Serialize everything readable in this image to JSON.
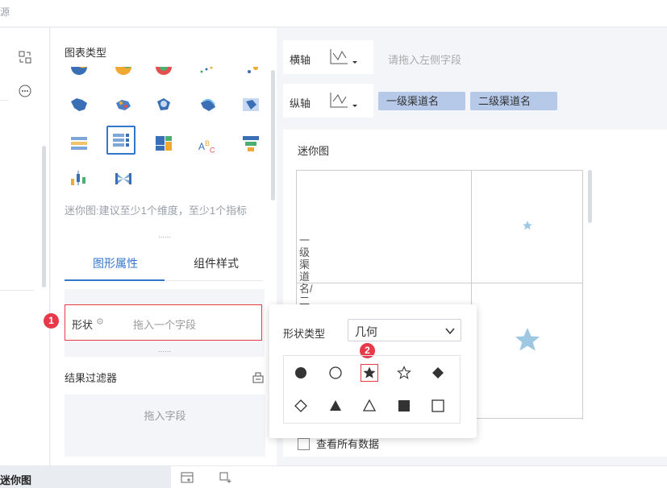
{
  "header": {
    "crumb": "源"
  },
  "chart_type_panel": {
    "title": "图表类型",
    "hint": "迷你图:建议至少1个维度，至少1个指标"
  },
  "tabs": [
    {
      "label": "图形属性"
    },
    {
      "label": "组件样式"
    }
  ],
  "shape_field": {
    "label": "形状",
    "placeholder": "拖入一个字段",
    "badge": "1"
  },
  "result_filter": {
    "title": "结果过滤器",
    "placeholder": "拖入字段"
  },
  "axes": {
    "x": {
      "label": "横轴",
      "placeholder": "请拖入左侧字段"
    },
    "y": {
      "label": "纵轴",
      "chips": [
        "一级渠道名",
        "二级渠道名"
      ]
    }
  },
  "canvas": {
    "title": "迷你图",
    "y_axis_label": "一级渠道名/二",
    "show_all": "查看所有数据",
    "star_color": "#9ec8e2"
  },
  "shape_popover": {
    "label": "形状类型",
    "selected": "几何",
    "badge": "2",
    "shapes": [
      "filled-circle",
      "hollow-circle",
      "filled-star",
      "hollow-star",
      "filled-diamond",
      "hollow-diamond",
      "filled-triangle",
      "hollow-triangle",
      "filled-square",
      "hollow-square"
    ],
    "selected_shape": "filled-star"
  },
  "bottom": {
    "sheet_name": "迷你图"
  },
  "colors": {
    "accent": "#3377cc",
    "alert": "#e8394a",
    "chip": "#b6c9e8"
  }
}
